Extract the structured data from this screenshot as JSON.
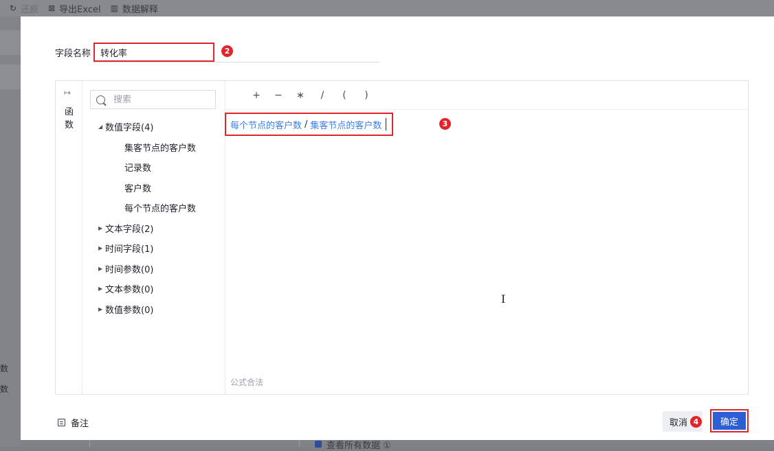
{
  "background": {
    "toolbar": {
      "undo_label": "还原",
      "export_label": "导出Excel",
      "explain_label": "数据解释"
    },
    "left_labels": [
      "数",
      "数"
    ],
    "bottom_text": "查看所有数据 ①"
  },
  "dialog": {
    "field_name_label": "字段名称",
    "field_name_value": "转化率",
    "function_tab_label": "函数",
    "search_placeholder": "搜索",
    "tree": [
      {
        "label": "数值字段(4)",
        "expanded": true,
        "children": [
          "集客节点的客户数",
          "记录数",
          "客户数",
          "每个节点的客户数"
        ]
      },
      {
        "label": "文本字段(2)",
        "expanded": false
      },
      {
        "label": "时间字段(1)",
        "expanded": false
      },
      {
        "label": "时间参数(0)",
        "expanded": false
      },
      {
        "label": "文本参数(0)",
        "expanded": false
      },
      {
        "label": "数值参数(0)",
        "expanded": false
      }
    ],
    "operators": [
      "+",
      "−",
      "∗",
      "/",
      "(",
      ")"
    ],
    "formula": {
      "token1": "每个节点的客户数",
      "operator": "/",
      "token2": "集客节点的客户数"
    },
    "validation_text": "公式合法",
    "note_label": "备注",
    "cancel_label": "取消",
    "confirm_label": "确定"
  },
  "annotations": {
    "badge_2": "2",
    "badge_3": "3",
    "badge_4": "4",
    "highlight_color": "#e0242b"
  }
}
